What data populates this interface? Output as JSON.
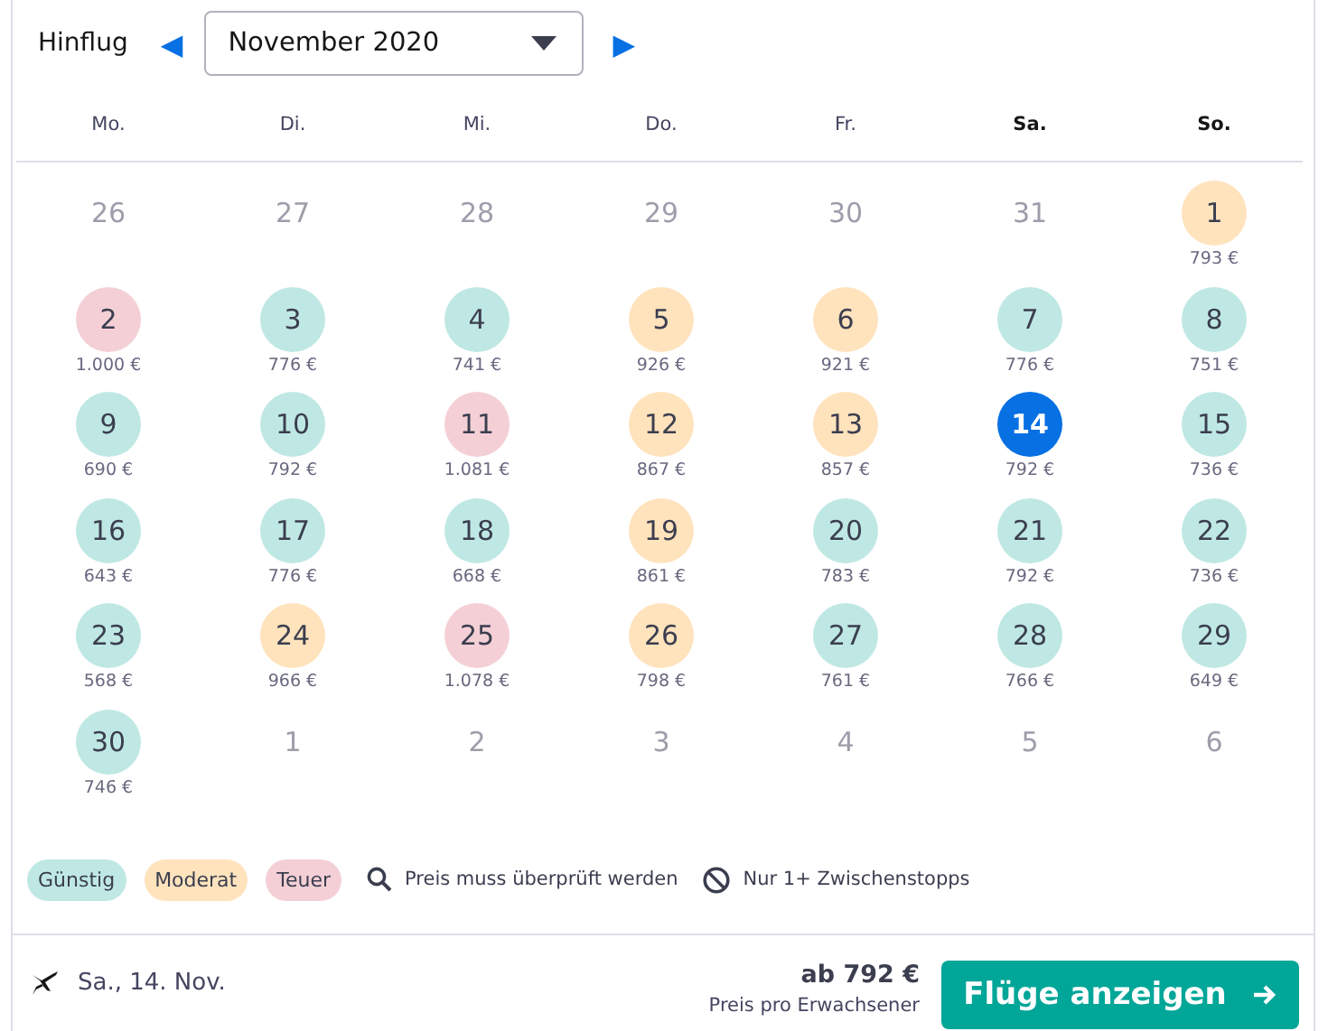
{
  "header": {
    "label": "Hinflug",
    "prev": "◀",
    "month": "November 2020",
    "next": "▶"
  },
  "weekdays": [
    {
      "label": "Mo.",
      "weekend": false
    },
    {
      "label": "Di.",
      "weekend": false
    },
    {
      "label": "Mi.",
      "weekend": false
    },
    {
      "label": "Do.",
      "weekend": false
    },
    {
      "label": "Fr.",
      "weekend": false
    },
    {
      "label": "Sa.",
      "weekend": true
    },
    {
      "label": "So.",
      "weekend": true
    }
  ],
  "days": [
    {
      "day": "26",
      "kind": "outside"
    },
    {
      "day": "27",
      "kind": "outside"
    },
    {
      "day": "28",
      "kind": "outside"
    },
    {
      "day": "29",
      "kind": "outside"
    },
    {
      "day": "30",
      "kind": "outside"
    },
    {
      "day": "31",
      "kind": "outside"
    },
    {
      "day": "1",
      "kind": "day",
      "price": "793 €",
      "color": "#ffe3bd",
      "selected": false
    },
    {
      "day": "2",
      "kind": "day",
      "price": "1.000 €",
      "color": "#f4d0d6",
      "selected": false
    },
    {
      "day": "3",
      "kind": "day",
      "price": "776 €",
      "color": "#bfe8e4",
      "selected": false
    },
    {
      "day": "4",
      "kind": "day",
      "price": "741 €",
      "color": "#bfe8e4",
      "selected": false
    },
    {
      "day": "5",
      "kind": "day",
      "price": "926 €",
      "color": "#ffe3bd",
      "selected": false
    },
    {
      "day": "6",
      "kind": "day",
      "price": "921 €",
      "color": "#ffe3bd",
      "selected": false
    },
    {
      "day": "7",
      "kind": "day",
      "price": "776 €",
      "color": "#bfe8e4",
      "selected": false
    },
    {
      "day": "8",
      "kind": "day",
      "price": "751 €",
      "color": "#bfe8e4",
      "selected": false
    },
    {
      "day": "9",
      "kind": "day",
      "price": "690 €",
      "color": "#bfe8e4",
      "selected": false
    },
    {
      "day": "10",
      "kind": "day",
      "price": "792 €",
      "color": "#bfe8e4",
      "selected": false
    },
    {
      "day": "11",
      "kind": "day",
      "price": "1.081 €",
      "color": "#f4d0d6",
      "selected": false
    },
    {
      "day": "12",
      "kind": "day",
      "price": "867 €",
      "color": "#ffe3bd",
      "selected": false
    },
    {
      "day": "13",
      "kind": "day",
      "price": "857 €",
      "color": "#ffe3bd",
      "selected": false
    },
    {
      "day": "14",
      "kind": "day",
      "price": "792 €",
      "selected": true
    },
    {
      "day": "15",
      "kind": "day",
      "price": "736 €",
      "color": "#bfe8e4",
      "selected": false
    },
    {
      "day": "16",
      "kind": "day",
      "price": "643 €",
      "color": "#bfe8e4",
      "selected": false
    },
    {
      "day": "17",
      "kind": "day",
      "price": "776 €",
      "color": "#bfe8e4",
      "selected": false
    },
    {
      "day": "18",
      "kind": "day",
      "price": "668 €",
      "color": "#bfe8e4",
      "selected": false
    },
    {
      "day": "19",
      "kind": "day",
      "price": "861 €",
      "color": "#ffe3bd",
      "selected": false
    },
    {
      "day": "20",
      "kind": "day",
      "price": "783 €",
      "color": "#bfe8e4",
      "selected": false
    },
    {
      "day": "21",
      "kind": "day",
      "price": "792 €",
      "color": "#bfe8e4",
      "selected": false
    },
    {
      "day": "22",
      "kind": "day",
      "price": "736 €",
      "color": "#bfe8e4",
      "selected": false
    },
    {
      "day": "23",
      "kind": "day",
      "price": "568 €",
      "color": "#bfe8e4",
      "selected": false
    },
    {
      "day": "24",
      "kind": "day",
      "price": "966 €",
      "color": "#ffe3bd",
      "selected": false
    },
    {
      "day": "25",
      "kind": "day",
      "price": "1.078 €",
      "color": "#f4d0d6",
      "selected": false
    },
    {
      "day": "26",
      "kind": "day",
      "price": "798 €",
      "color": "#ffe3bd",
      "selected": false
    },
    {
      "day": "27",
      "kind": "day",
      "price": "761 €",
      "color": "#bfe8e4",
      "selected": false
    },
    {
      "day": "28",
      "kind": "day",
      "price": "766 €",
      "color": "#bfe8e4",
      "selected": false
    },
    {
      "day": "29",
      "kind": "day",
      "price": "649 €",
      "color": "#bfe8e4",
      "selected": false
    },
    {
      "day": "30",
      "kind": "day",
      "price": "746 €",
      "color": "#bfe8e4",
      "selected": false
    },
    {
      "day": "1",
      "kind": "outside"
    },
    {
      "day": "2",
      "kind": "outside"
    },
    {
      "day": "3",
      "kind": "outside"
    },
    {
      "day": "4",
      "kind": "outside"
    },
    {
      "day": "5",
      "kind": "outside"
    },
    {
      "day": "6",
      "kind": "outside"
    }
  ],
  "legend": [
    {
      "label": "Günstig",
      "kind": "chip",
      "color": "#bfe8e4"
    },
    {
      "label": "Moderat",
      "kind": "chip",
      "color": "#ffe3bd"
    },
    {
      "label": "Teuer",
      "kind": "chip",
      "color": "#f4d0d6"
    },
    {
      "label": "Preis muss überprüft werden",
      "kind": "search"
    },
    {
      "label": "Nur 1+ Zwischenstopps",
      "kind": "stops"
    }
  ],
  "footer": {
    "date": "Sa., 14. Nov.",
    "price": "ab 792 €",
    "price_note": "Preis pro Erwachsener",
    "button": "Flüge anzeigen"
  }
}
